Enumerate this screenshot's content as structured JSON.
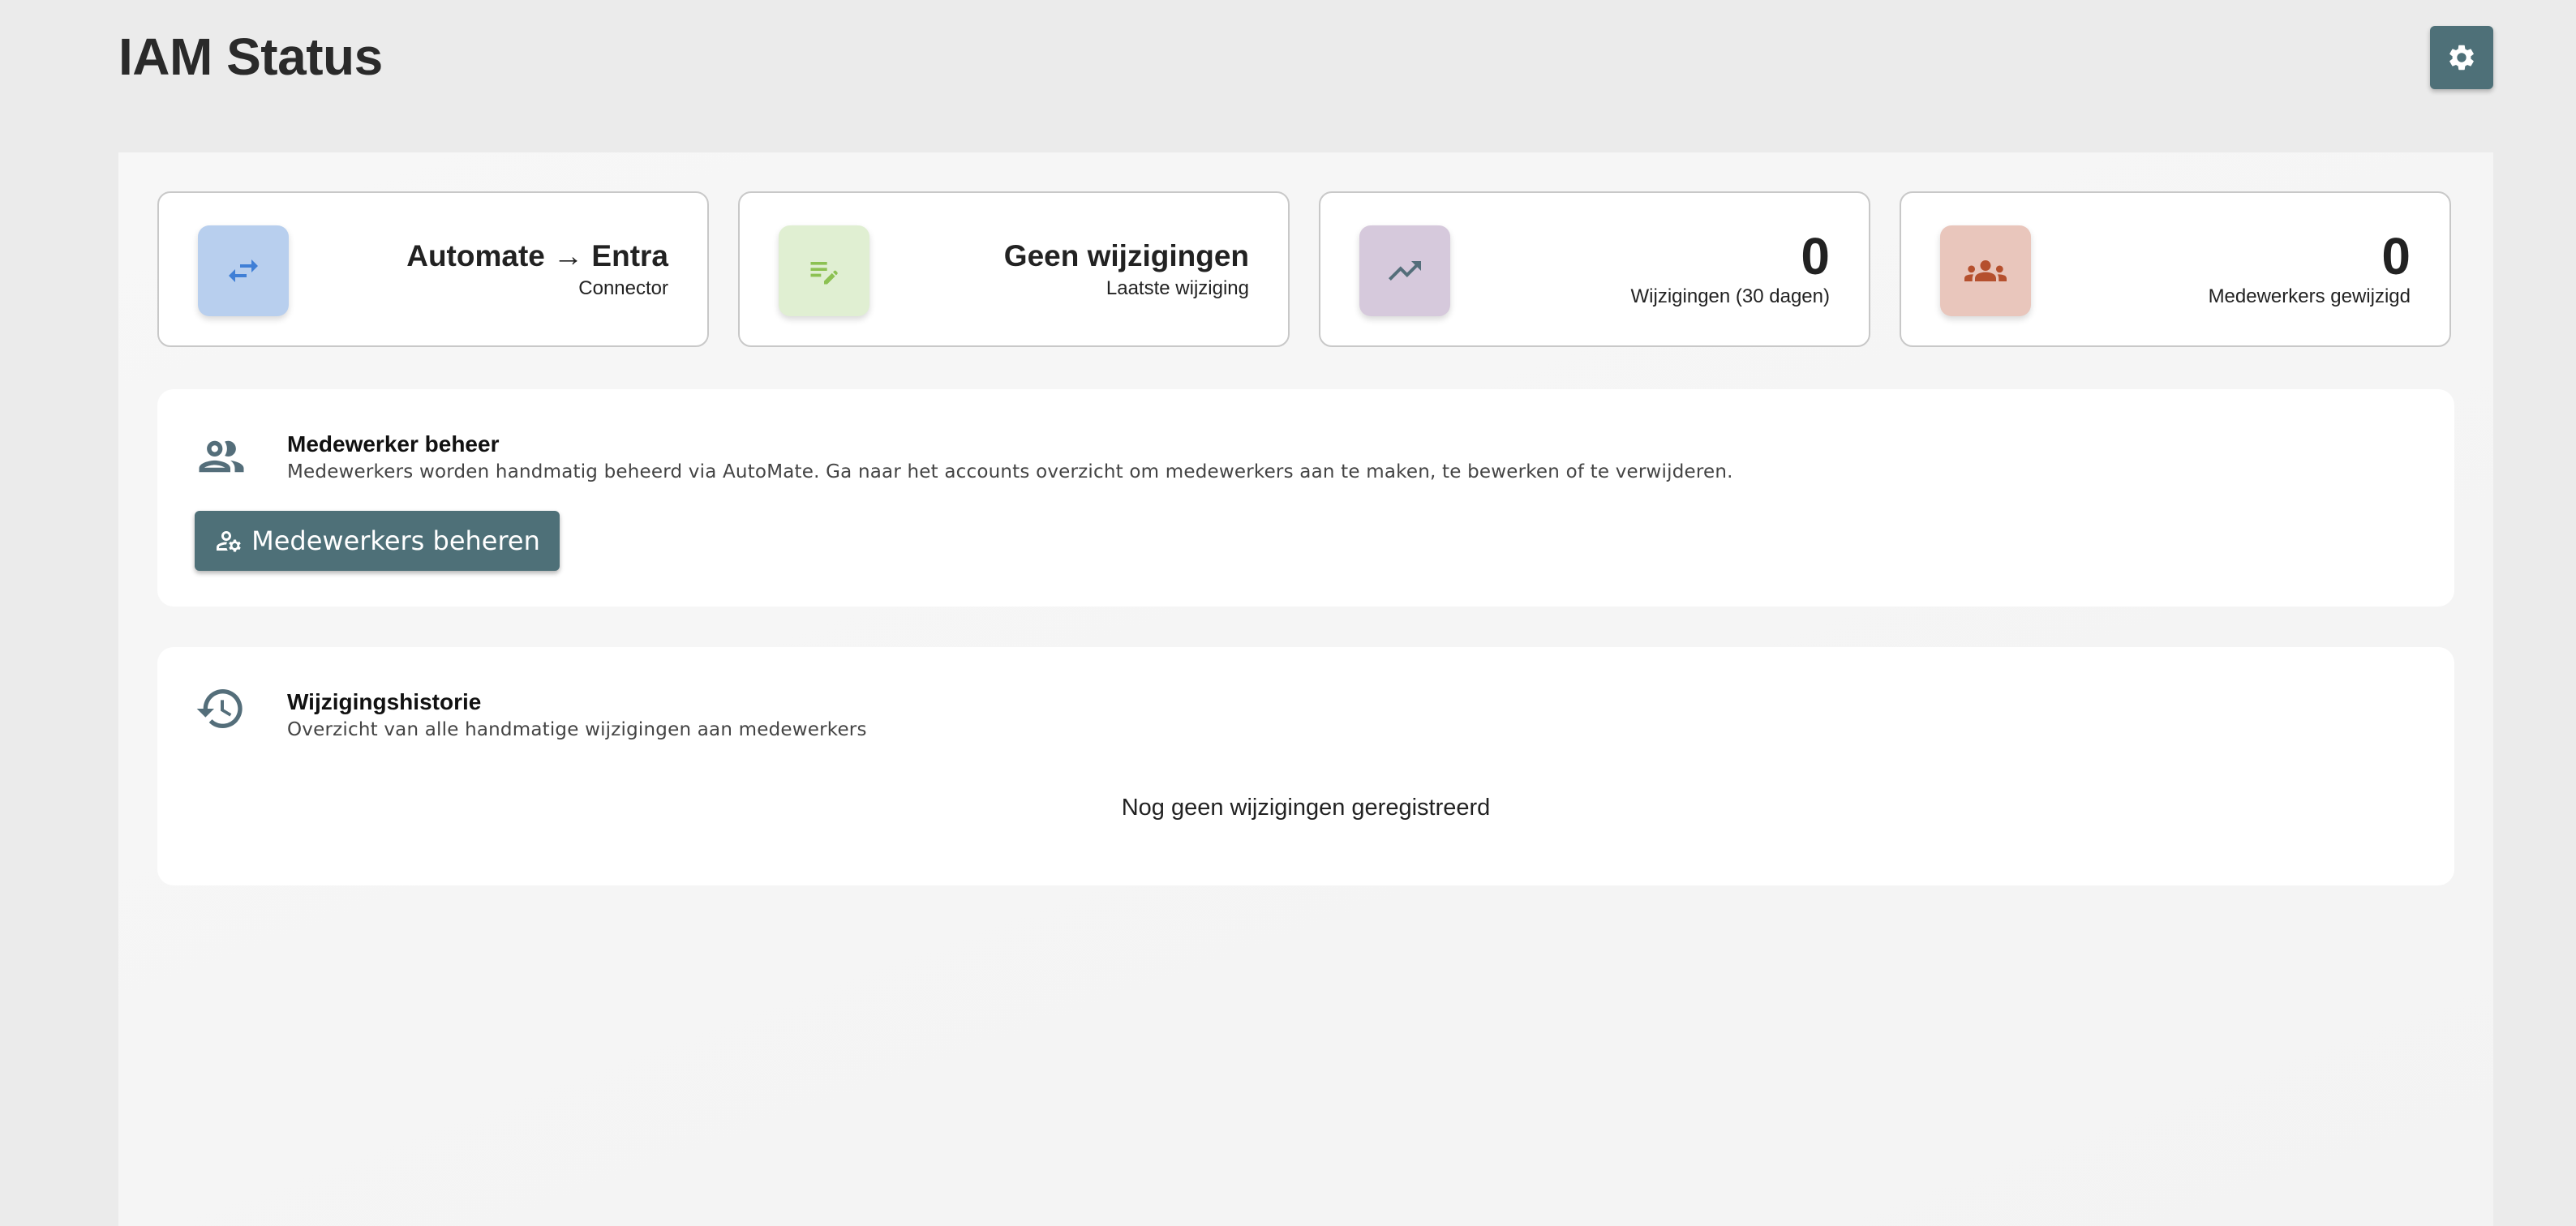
{
  "header": {
    "title": "IAM Status",
    "settings_icon": "gear-icon"
  },
  "stats": [
    {
      "title": "Automate → Entra",
      "subtitle": "Connector",
      "icon": "arrows-swap-icon",
      "icon_bg": "#b8cfee",
      "icon_color": "#3f7fd6"
    },
    {
      "title": "Geen wijzigingen",
      "subtitle": "Laatste wijziging",
      "icon": "edit-note-icon",
      "icon_bg": "#e0efd2",
      "icon_color": "#8cc152"
    },
    {
      "value": "0",
      "subtitle": "Wijzigingen (30 dagen)",
      "icon": "trending-up-icon",
      "icon_bg": "#d6c9dc",
      "icon_color": "#546e7a"
    },
    {
      "value": "0",
      "subtitle": "Medewerkers gewijzigd",
      "icon": "groups-icon",
      "icon_bg": "#e9c6bc",
      "icon_color": "#b5502e"
    }
  ],
  "employee_management": {
    "title": "Medewerker beheer",
    "description": "Medewerkers worden handmatig beheerd via AutoMate. Ga naar het accounts overzicht om medewerkers aan te maken, te bewerken of te verwijderen.",
    "button_label": "Medewerkers beheren",
    "icon": "people-icon"
  },
  "history": {
    "title": "Wijzigingshistorie",
    "description": "Overzicht van alle handmatige wijzigingen aan medewerkers",
    "empty_text": "Nog geen wijzigingen geregistreerd",
    "icon": "history-icon"
  },
  "colors": {
    "primary": "#4e7078",
    "background": "#ebebeb",
    "panel": "#f5f5f5",
    "card": "#ffffff"
  }
}
